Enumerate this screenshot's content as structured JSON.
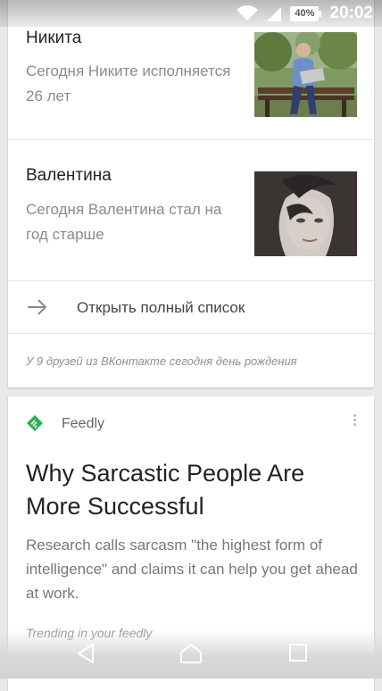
{
  "status_bar": {
    "battery": "40%",
    "time": "20:02"
  },
  "birthdays": {
    "people": [
      {
        "name": "Никита",
        "description": "Сегодня Никите исполняется 26 лет"
      },
      {
        "name": "Валентина",
        "description": "Сегодня Валентина стал на год старше"
      }
    ],
    "open_list_label": "Открыть полный список",
    "footer": "У 9 друзей из ВКонтакте сегодня день рождения"
  },
  "feedly_card": {
    "source": "Feedly",
    "headline": "Why Sarcastic People Are More Successful",
    "summary": "Research calls sarcasm \"the highest form of intelligence\" and claims it can help you get ahead at work.",
    "trending": "Trending in your feedly"
  },
  "colors": {
    "feedly_green": "#2bb24c",
    "background": "#e9e9e9"
  },
  "icons": [
    "wifi-icon",
    "signal-icon",
    "battery-icon",
    "arrow-right-icon",
    "feedly-logo-icon",
    "more-vert-icon",
    "back-icon",
    "home-icon",
    "recents-icon"
  ]
}
